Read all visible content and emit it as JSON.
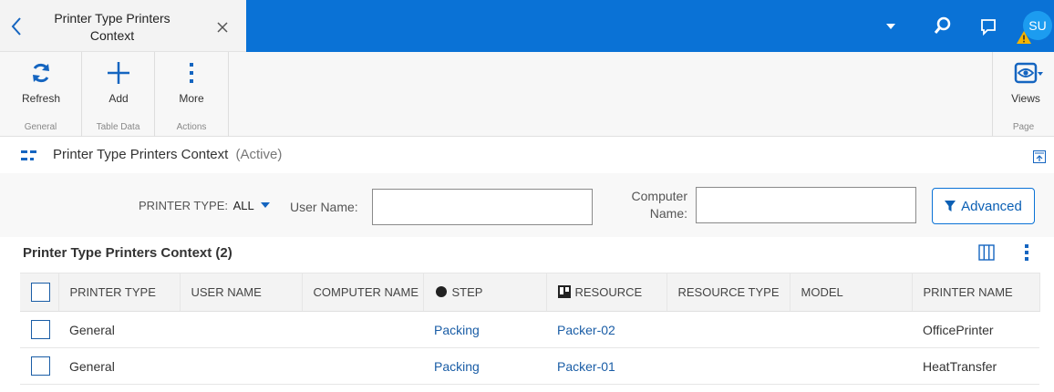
{
  "tab": {
    "title_line1": "Printer Type Printers",
    "title_line2": "Context"
  },
  "header": {
    "avatar_initials": "SU"
  },
  "ribbon": {
    "groups": [
      {
        "name": "General",
        "buttons": [
          {
            "label": "Refresh",
            "icon": "refresh-icon"
          }
        ]
      },
      {
        "name": "Table Data",
        "buttons": [
          {
            "label": "Add",
            "icon": "plus-icon"
          }
        ]
      },
      {
        "name": "Actions",
        "buttons": [
          {
            "label": "More",
            "icon": "more-vertical-icon"
          }
        ]
      }
    ],
    "right_group": {
      "name": "Page",
      "button": {
        "label": "Views",
        "icon": "eye-icon"
      }
    }
  },
  "context": {
    "title": "Printer Type Printers Context",
    "status": "(Active)"
  },
  "filters": {
    "printer_type_label": "PRINTER TYPE:",
    "printer_type_value": "ALL",
    "user_name_label": "User Name:",
    "user_name_value": "",
    "computer_name_label_line1": "Computer",
    "computer_name_label_line2": "Name:",
    "computer_name_value": "",
    "advanced_label": "Advanced"
  },
  "grid": {
    "title": "Printer Type Printers Context (2)",
    "columns": [
      "PRINTER TYPE",
      "USER NAME",
      "COMPUTER NAME",
      "STEP",
      "RESOURCE",
      "RESOURCE TYPE",
      "MODEL",
      "PRINTER NAME"
    ],
    "rows": [
      {
        "printer_type": "General",
        "user_name": "",
        "computer_name": "",
        "step": "Packing",
        "resource": "Packer-02",
        "resource_type": "",
        "model": "",
        "printer_name": "OfficePrinter"
      },
      {
        "printer_type": "General",
        "user_name": "",
        "computer_name": "",
        "step": "Packing",
        "resource": "Packer-01",
        "resource_type": "",
        "model": "",
        "printer_name": "HeatTransfer"
      }
    ]
  },
  "colors": {
    "brand_blue": "#0a72d6",
    "link_blue": "#1a5da6",
    "avatar": "#1c9cf0",
    "warning": "#f4b400"
  }
}
